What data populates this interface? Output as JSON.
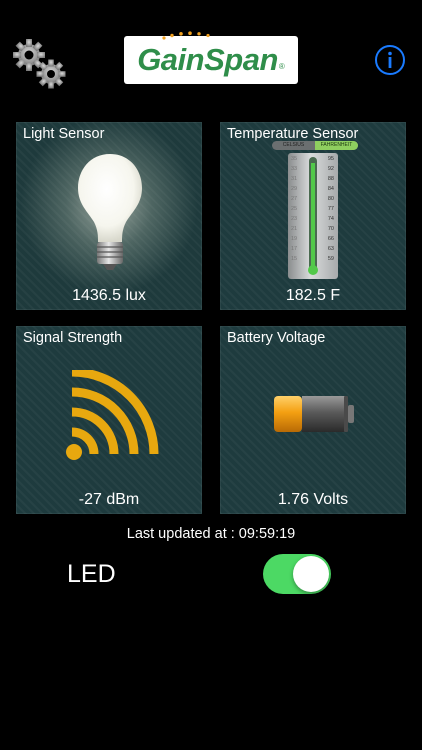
{
  "header": {
    "logo_text": "GainSpan",
    "logo_registered": "®"
  },
  "tiles": {
    "light": {
      "title": "Light Sensor",
      "value": "1436.5 lux"
    },
    "temperature": {
      "title": "Temperature Sensor",
      "value": "182.5 F",
      "scale_toggle": [
        "CELSIUS",
        "FAHRENHEIT"
      ],
      "scale_selected": "FAHRENHEIT",
      "celsius_ticks": [
        "35",
        "33",
        "31",
        "29",
        "27",
        "25",
        "23",
        "21",
        "19",
        "17",
        "15"
      ],
      "fahrenheit_ticks": [
        "95",
        "92",
        "88",
        "84",
        "80",
        "77",
        "74",
        "70",
        "66",
        "63",
        "59"
      ]
    },
    "signal": {
      "title": "Signal Strength",
      "value": "-27 dBm"
    },
    "battery": {
      "title": "Battery Voltage",
      "value": "1.76 Volts"
    }
  },
  "status": {
    "last_updated": "Last updated at : 09:59:19"
  },
  "led": {
    "label": "LED",
    "state": "on",
    "on_color": "#4cd964"
  },
  "colors": {
    "tile_bg": "#1e3b3e",
    "accent_blue": "#1a7bff",
    "logo_green": "#2f8e4a",
    "icon_yellow": "#e8a80f"
  }
}
